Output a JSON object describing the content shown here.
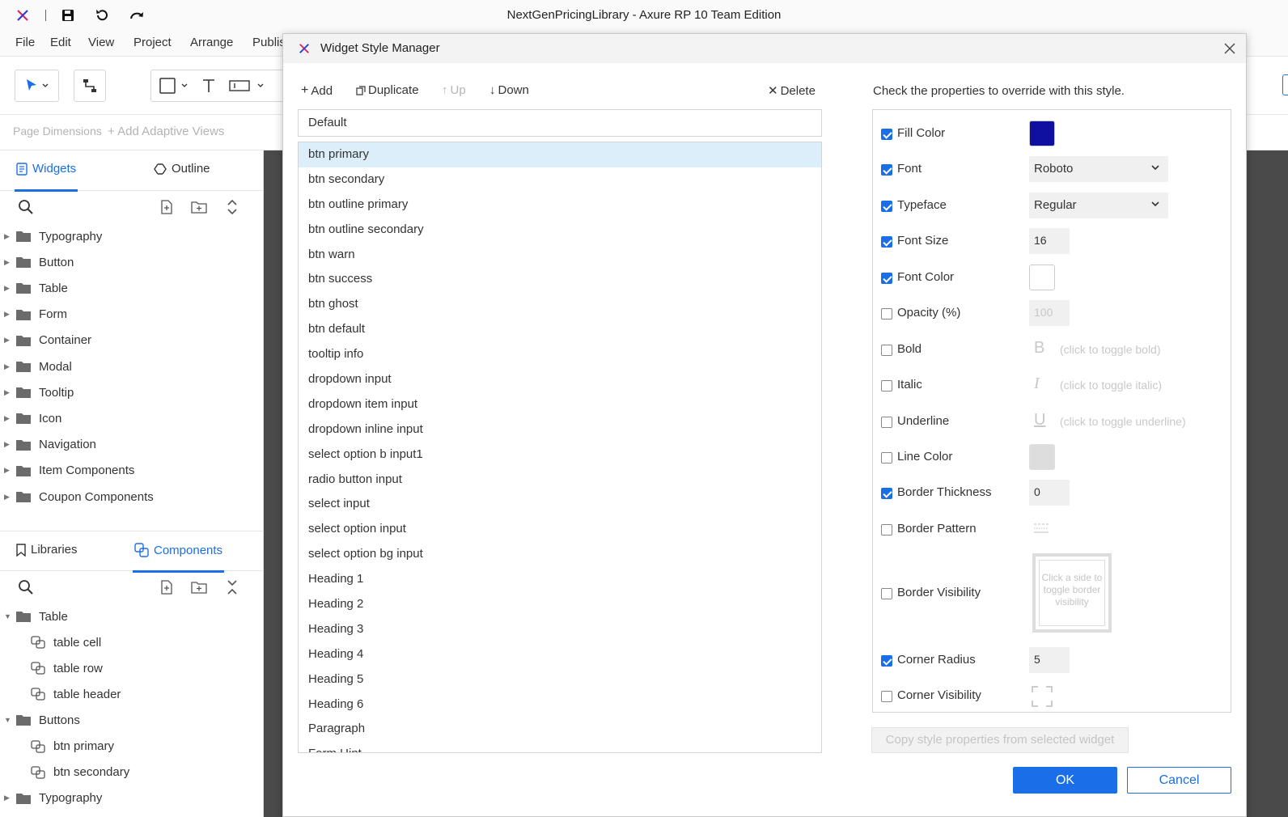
{
  "app": {
    "window_title": "NextGenPricingLibrary - Axure RP 10 Team Edition",
    "icons": [
      "axure-logo-icon",
      "save-icon",
      "undo-icon",
      "redo-icon"
    ]
  },
  "menubar": [
    "File",
    "Edit",
    "View",
    "Project",
    "Arrange",
    "Publis"
  ],
  "pagebar": {
    "page_dimensions": "Page Dimensions",
    "add_adaptive": "+ Add Adaptive Views"
  },
  "widgets_pane": {
    "tab_widgets": "Widgets",
    "tab_outline": "Outline",
    "folders": [
      "Typography",
      "Button",
      "Table",
      "Form",
      "Container",
      "Modal",
      "Tooltip",
      "Icon",
      "Navigation",
      "Item Components",
      "Coupon Components"
    ]
  },
  "components_pane": {
    "tab_libraries": "Libraries",
    "tab_components": "Components",
    "tree": [
      {
        "label": "Table",
        "type": "folder",
        "expanded": true
      },
      {
        "label": "table cell",
        "type": "component"
      },
      {
        "label": "table row",
        "type": "component"
      },
      {
        "label": "table header",
        "type": "component"
      },
      {
        "label": "Buttons",
        "type": "folder",
        "expanded": true
      },
      {
        "label": "btn primary",
        "type": "component"
      },
      {
        "label": "btn secondary",
        "type": "component"
      },
      {
        "label": "Typography",
        "type": "folder",
        "expanded": false
      }
    ]
  },
  "modal": {
    "title": "Widget Style Manager",
    "toolbar": {
      "add": "Add",
      "duplicate": "Duplicate",
      "up": "Up",
      "down": "Down",
      "delete": "Delete"
    },
    "default_style": "Default",
    "selected_style": "btn primary",
    "styles": [
      "btn primary",
      "btn secondary",
      "btn outline primary",
      "btn outline secondary",
      "btn warn",
      "btn success",
      "btn ghost",
      "btn default",
      "tooltip info",
      "dropdown input",
      "dropdown item input",
      "dropdown inline input",
      "select option b input1",
      "radio button input",
      "select input",
      "select option input",
      "select option bg input",
      "Heading 1",
      "Heading 2",
      "Heading 3",
      "Heading 4",
      "Heading 5",
      "Heading 6",
      "Paragraph",
      "Form Hint"
    ],
    "properties_hint": "Check the properties to override with this style.",
    "properties": {
      "fill_color": {
        "label": "Fill Color",
        "checked": true,
        "color": "#1010a0"
      },
      "font": {
        "label": "Font",
        "checked": true,
        "value": "Roboto"
      },
      "typeface": {
        "label": "Typeface",
        "checked": true,
        "value": "Regular"
      },
      "font_size": {
        "label": "Font Size",
        "checked": true,
        "value": "16"
      },
      "font_color": {
        "label": "Font Color",
        "checked": true,
        "color": "#ffffff"
      },
      "opacity": {
        "label": "Opacity (%)",
        "checked": false,
        "value": "100"
      },
      "bold": {
        "label": "Bold",
        "checked": false,
        "glyph": "B",
        "hint": "(click to toggle bold)"
      },
      "italic": {
        "label": "Italic",
        "checked": false,
        "glyph": "I",
        "hint": "(click to toggle italic)"
      },
      "underline": {
        "label": "Underline",
        "checked": false,
        "glyph": "U",
        "hint": "(click to toggle underline)"
      },
      "line_color": {
        "label": "Line Color",
        "checked": false,
        "color": "#dddddd"
      },
      "border_thickness": {
        "label": "Border Thickness",
        "checked": true,
        "value": "0"
      },
      "border_pattern": {
        "label": "Border Pattern",
        "checked": false
      },
      "border_visibility": {
        "label": "Border Visibility",
        "checked": false,
        "hint": "Click a side to toggle border visibility"
      },
      "corner_radius": {
        "label": "Corner Radius",
        "checked": true,
        "value": "5"
      },
      "corner_visibility": {
        "label": "Corner Visibility",
        "checked": false
      }
    },
    "copy_button": "Copy style properties from selected widget",
    "ok": "OK",
    "cancel": "Cancel"
  },
  "colors": {
    "accent": "#1a6fe8",
    "selected_row": "#ddeefb",
    "canvas": "#4a4a4a"
  }
}
